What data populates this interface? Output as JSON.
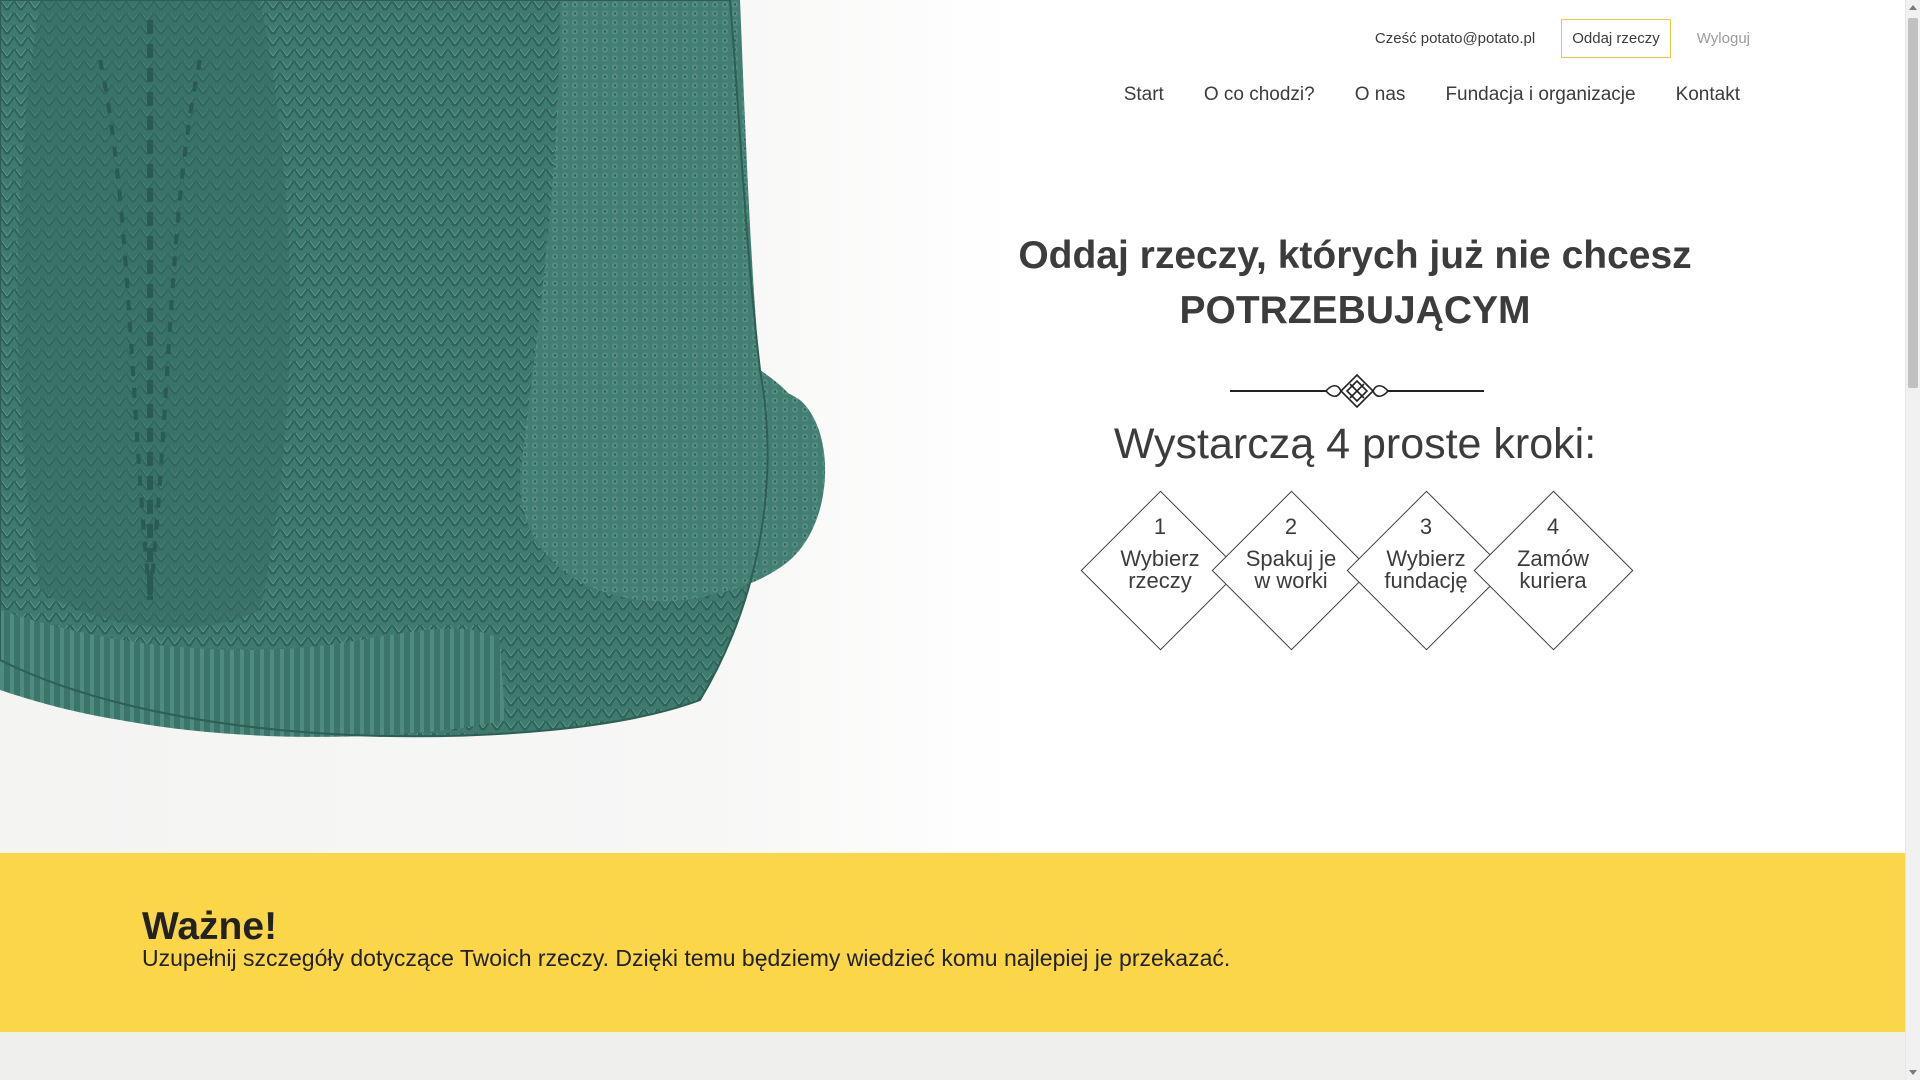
{
  "header": {
    "greeting": "Cześć potato@potato.pl",
    "give_button": "Oddaj rzeczy",
    "logout": "Wyloguj"
  },
  "nav": {
    "items": [
      {
        "label": "Start"
      },
      {
        "label": "O co chodzi?"
      },
      {
        "label": "O nas"
      },
      {
        "label": "Fundacja i organizacje"
      },
      {
        "label": "Kontakt"
      }
    ]
  },
  "hero": {
    "title_line1": "Oddaj rzeczy, których już nie chcesz",
    "title_line2": "POTRZEBUJĄCYM",
    "steps_title": "Wystarczą 4 proste kroki:",
    "steps": [
      {
        "number": "1",
        "line1": "Wybierz",
        "line2": "rzeczy"
      },
      {
        "number": "2",
        "line1": "Spakuj je",
        "line2": "w worki"
      },
      {
        "number": "3",
        "line1": "Wybierz",
        "line2": "fundację"
      },
      {
        "number": "4",
        "line1": "Zamów",
        "line2": "kuriera"
      }
    ]
  },
  "banner": {
    "title": "Ważne!",
    "text": "Uzupełnij szczegóły dotyczące Twoich rzeczy. Dzięki temu będziemy wiedzieć komu najlepiej je przekazać."
  },
  "colors": {
    "accent_yellow": "#fad648",
    "button_border": "#f4c542",
    "sweater": "#3f7a6e",
    "text": "#3c3c3c"
  }
}
